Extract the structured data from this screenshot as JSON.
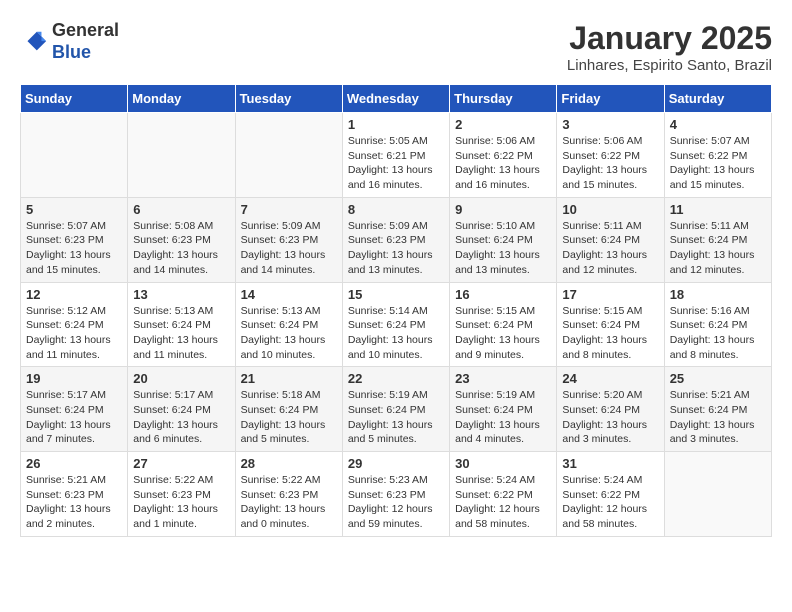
{
  "header": {
    "logo_general": "General",
    "logo_blue": "Blue",
    "month_title": "January 2025",
    "location": "Linhares, Espirito Santo, Brazil"
  },
  "weekdays": [
    "Sunday",
    "Monday",
    "Tuesday",
    "Wednesday",
    "Thursday",
    "Friday",
    "Saturday"
  ],
  "weeks": [
    [
      {
        "day": "",
        "info": ""
      },
      {
        "day": "",
        "info": ""
      },
      {
        "day": "",
        "info": ""
      },
      {
        "day": "1",
        "info": "Sunrise: 5:05 AM\nSunset: 6:21 PM\nDaylight: 13 hours\nand 16 minutes."
      },
      {
        "day": "2",
        "info": "Sunrise: 5:06 AM\nSunset: 6:22 PM\nDaylight: 13 hours\nand 16 minutes."
      },
      {
        "day": "3",
        "info": "Sunrise: 5:06 AM\nSunset: 6:22 PM\nDaylight: 13 hours\nand 15 minutes."
      },
      {
        "day": "4",
        "info": "Sunrise: 5:07 AM\nSunset: 6:22 PM\nDaylight: 13 hours\nand 15 minutes."
      }
    ],
    [
      {
        "day": "5",
        "info": "Sunrise: 5:07 AM\nSunset: 6:23 PM\nDaylight: 13 hours\nand 15 minutes."
      },
      {
        "day": "6",
        "info": "Sunrise: 5:08 AM\nSunset: 6:23 PM\nDaylight: 13 hours\nand 14 minutes."
      },
      {
        "day": "7",
        "info": "Sunrise: 5:09 AM\nSunset: 6:23 PM\nDaylight: 13 hours\nand 14 minutes."
      },
      {
        "day": "8",
        "info": "Sunrise: 5:09 AM\nSunset: 6:23 PM\nDaylight: 13 hours\nand 13 minutes."
      },
      {
        "day": "9",
        "info": "Sunrise: 5:10 AM\nSunset: 6:24 PM\nDaylight: 13 hours\nand 13 minutes."
      },
      {
        "day": "10",
        "info": "Sunrise: 5:11 AM\nSunset: 6:24 PM\nDaylight: 13 hours\nand 12 minutes."
      },
      {
        "day": "11",
        "info": "Sunrise: 5:11 AM\nSunset: 6:24 PM\nDaylight: 13 hours\nand 12 minutes."
      }
    ],
    [
      {
        "day": "12",
        "info": "Sunrise: 5:12 AM\nSunset: 6:24 PM\nDaylight: 13 hours\nand 11 minutes."
      },
      {
        "day": "13",
        "info": "Sunrise: 5:13 AM\nSunset: 6:24 PM\nDaylight: 13 hours\nand 11 minutes."
      },
      {
        "day": "14",
        "info": "Sunrise: 5:13 AM\nSunset: 6:24 PM\nDaylight: 13 hours\nand 10 minutes."
      },
      {
        "day": "15",
        "info": "Sunrise: 5:14 AM\nSunset: 6:24 PM\nDaylight: 13 hours\nand 10 minutes."
      },
      {
        "day": "16",
        "info": "Sunrise: 5:15 AM\nSunset: 6:24 PM\nDaylight: 13 hours\nand 9 minutes."
      },
      {
        "day": "17",
        "info": "Sunrise: 5:15 AM\nSunset: 6:24 PM\nDaylight: 13 hours\nand 8 minutes."
      },
      {
        "day": "18",
        "info": "Sunrise: 5:16 AM\nSunset: 6:24 PM\nDaylight: 13 hours\nand 8 minutes."
      }
    ],
    [
      {
        "day": "19",
        "info": "Sunrise: 5:17 AM\nSunset: 6:24 PM\nDaylight: 13 hours\nand 7 minutes."
      },
      {
        "day": "20",
        "info": "Sunrise: 5:17 AM\nSunset: 6:24 PM\nDaylight: 13 hours\nand 6 minutes."
      },
      {
        "day": "21",
        "info": "Sunrise: 5:18 AM\nSunset: 6:24 PM\nDaylight: 13 hours\nand 5 minutes."
      },
      {
        "day": "22",
        "info": "Sunrise: 5:19 AM\nSunset: 6:24 PM\nDaylight: 13 hours\nand 5 minutes."
      },
      {
        "day": "23",
        "info": "Sunrise: 5:19 AM\nSunset: 6:24 PM\nDaylight: 13 hours\nand 4 minutes."
      },
      {
        "day": "24",
        "info": "Sunrise: 5:20 AM\nSunset: 6:24 PM\nDaylight: 13 hours\nand 3 minutes."
      },
      {
        "day": "25",
        "info": "Sunrise: 5:21 AM\nSunset: 6:24 PM\nDaylight: 13 hours\nand 3 minutes."
      }
    ],
    [
      {
        "day": "26",
        "info": "Sunrise: 5:21 AM\nSunset: 6:23 PM\nDaylight: 13 hours\nand 2 minutes."
      },
      {
        "day": "27",
        "info": "Sunrise: 5:22 AM\nSunset: 6:23 PM\nDaylight: 13 hours\nand 1 minute."
      },
      {
        "day": "28",
        "info": "Sunrise: 5:22 AM\nSunset: 6:23 PM\nDaylight: 13 hours\nand 0 minutes."
      },
      {
        "day": "29",
        "info": "Sunrise: 5:23 AM\nSunset: 6:23 PM\nDaylight: 12 hours\nand 59 minutes."
      },
      {
        "day": "30",
        "info": "Sunrise: 5:24 AM\nSunset: 6:22 PM\nDaylight: 12 hours\nand 58 minutes."
      },
      {
        "day": "31",
        "info": "Sunrise: 5:24 AM\nSunset: 6:22 PM\nDaylight: 12 hours\nand 58 minutes."
      },
      {
        "day": "",
        "info": ""
      }
    ]
  ]
}
